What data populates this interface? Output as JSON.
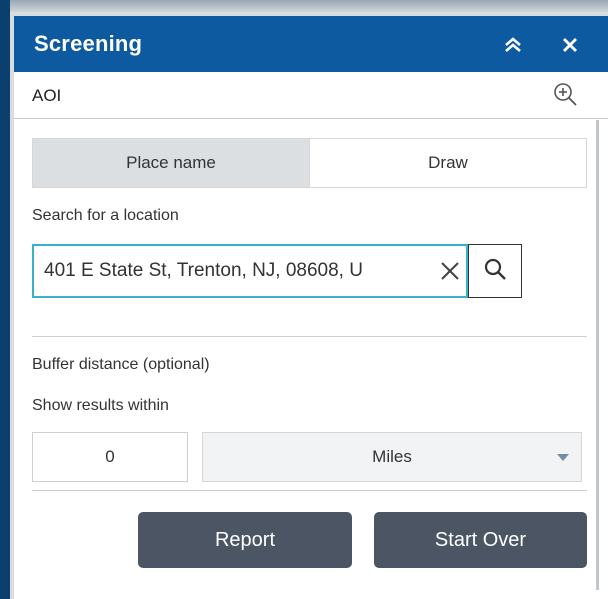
{
  "header": {
    "title": "Screening"
  },
  "aoi": {
    "label": "AOI"
  },
  "tabs": [
    {
      "label": "Place name",
      "active": true
    },
    {
      "label": "Draw",
      "active": false
    }
  ],
  "search": {
    "label": "Search for a location",
    "value": "401 E State St, Trenton, NJ, 08608, U"
  },
  "buffer": {
    "label": "Buffer distance (optional)",
    "within_label": "Show results within",
    "distance_value": "0",
    "unit_selected": "Miles"
  },
  "actions": {
    "report_label": "Report",
    "start_over_label": "Start Over"
  },
  "colors": {
    "header_bg": "#0e5aa0",
    "search_border": "#3ab1c8",
    "button_bg": "#4b5563"
  },
  "icons": [
    "double-chevron-up-icon",
    "close-icon",
    "zoom-in-icon",
    "clear-icon",
    "search-icon",
    "dropdown-caret-icon"
  ]
}
